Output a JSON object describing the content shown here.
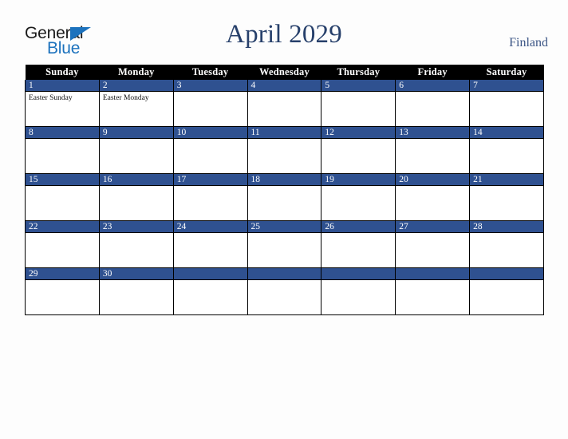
{
  "brand": {
    "name_part1": "General",
    "name_part2": "Blue",
    "triangle_color": "#1c72bd"
  },
  "header": {
    "title": "April 2029",
    "country": "Finland",
    "title_color": "#27406b",
    "country_color": "#3b5585"
  },
  "calendar": {
    "month": "April",
    "year": "2029",
    "accent_color": "#2f5190",
    "header_bg": "#000000",
    "weekday_headers": [
      "Sunday",
      "Monday",
      "Tuesday",
      "Wednesday",
      "Thursday",
      "Friday",
      "Saturday"
    ],
    "weeks": [
      {
        "days": [
          {
            "number": "1",
            "events": [
              "Easter Sunday"
            ]
          },
          {
            "number": "2",
            "events": [
              "Easter Monday"
            ]
          },
          {
            "number": "3",
            "events": []
          },
          {
            "number": "4",
            "events": []
          },
          {
            "number": "5",
            "events": []
          },
          {
            "number": "6",
            "events": []
          },
          {
            "number": "7",
            "events": []
          }
        ]
      },
      {
        "days": [
          {
            "number": "8",
            "events": []
          },
          {
            "number": "9",
            "events": []
          },
          {
            "number": "10",
            "events": []
          },
          {
            "number": "11",
            "events": []
          },
          {
            "number": "12",
            "events": []
          },
          {
            "number": "13",
            "events": []
          },
          {
            "number": "14",
            "events": []
          }
        ]
      },
      {
        "days": [
          {
            "number": "15",
            "events": []
          },
          {
            "number": "16",
            "events": []
          },
          {
            "number": "17",
            "events": []
          },
          {
            "number": "18",
            "events": []
          },
          {
            "number": "19",
            "events": []
          },
          {
            "number": "20",
            "events": []
          },
          {
            "number": "21",
            "events": []
          }
        ]
      },
      {
        "days": [
          {
            "number": "22",
            "events": []
          },
          {
            "number": "23",
            "events": []
          },
          {
            "number": "24",
            "events": []
          },
          {
            "number": "25",
            "events": []
          },
          {
            "number": "26",
            "events": []
          },
          {
            "number": "27",
            "events": []
          },
          {
            "number": "28",
            "events": []
          }
        ]
      },
      {
        "days": [
          {
            "number": "29",
            "events": []
          },
          {
            "number": "30",
            "events": []
          },
          {
            "number": "",
            "events": []
          },
          {
            "number": "",
            "events": []
          },
          {
            "number": "",
            "events": []
          },
          {
            "number": "",
            "events": []
          },
          {
            "number": "",
            "events": []
          }
        ]
      }
    ]
  }
}
